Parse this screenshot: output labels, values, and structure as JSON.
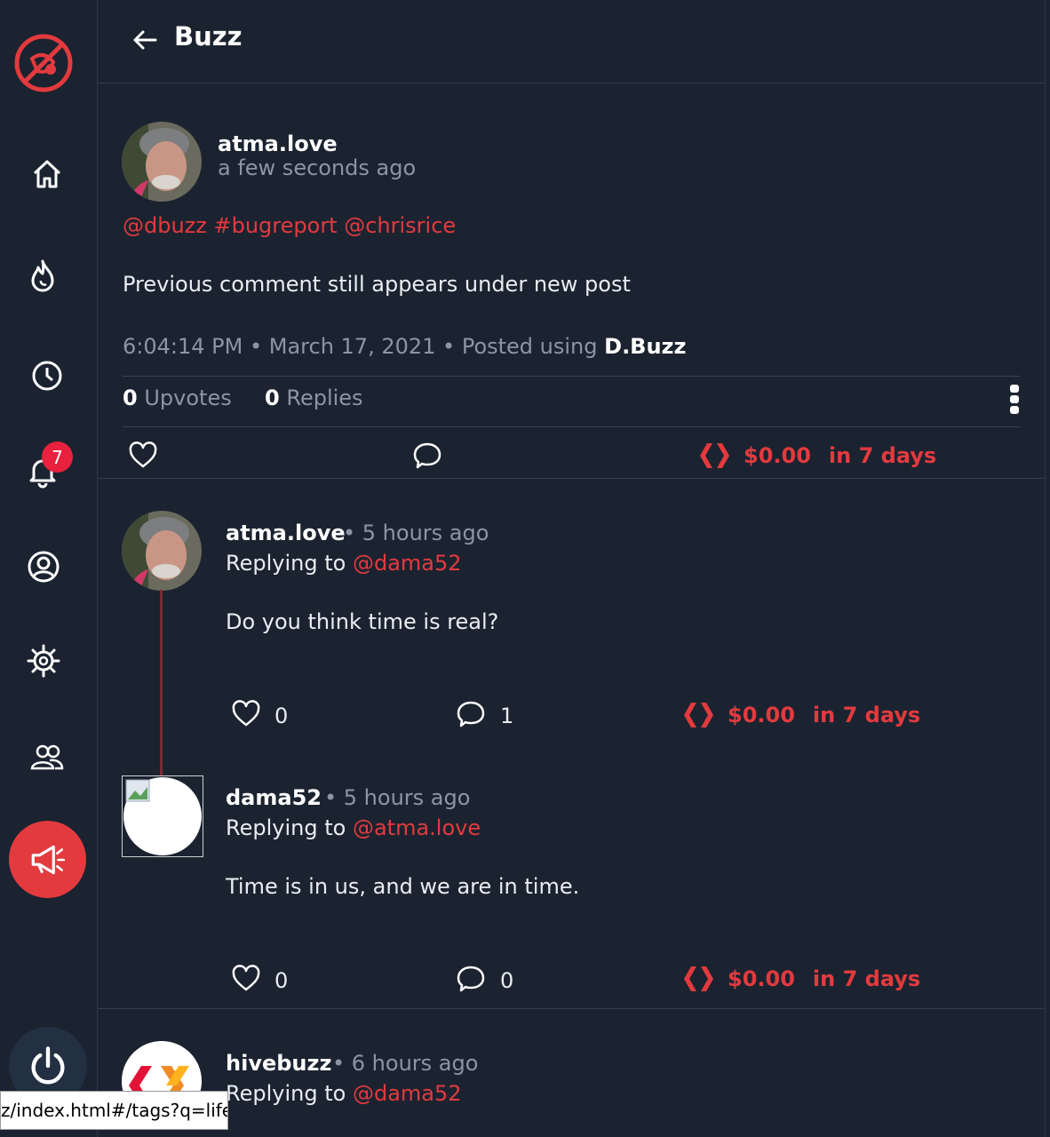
{
  "header": {
    "title": "Buzz"
  },
  "sidebar": {
    "notification_count": "7"
  },
  "post": {
    "author": "atma.love",
    "time_ago": "a few seconds ago",
    "tags": "@dbuzz #bugreport @chrisrice",
    "body": "Previous comment still appears under new post",
    "timestamp": "6:04:14 PM • March 17, 2021 • Posted using",
    "app": "D.Buzz",
    "upvotes_count": "0",
    "upvotes_label": "Upvotes",
    "replies_count": "0",
    "replies_label": "Replies",
    "payout": "$0.00",
    "payout_when": "in 7 days"
  },
  "replies": [
    {
      "author": "atma.love",
      "time_ago": "• 5 hours ago",
      "replying_label": "Replying to",
      "replying_to": "@dama52",
      "body": "Do you think time is real?",
      "likes": "0",
      "comments": "1",
      "payout": "$0.00",
      "payout_when": "in 7 days"
    },
    {
      "author": "dama52",
      "time_ago": "• 5 hours ago",
      "replying_label": "Replying to",
      "replying_to": "@atma.love",
      "body": "Time is in us, and we are in time.",
      "likes": "0",
      "comments": "0",
      "payout": "$0.00",
      "payout_when": "in 7 days"
    },
    {
      "author": "hivebuzz",
      "time_ago": "• 6 hours ago",
      "replying_label": "Replying to",
      "replying_to": "@dama52"
    }
  ],
  "status_bar": {
    "url": "z/index.html#/tags?q=life"
  },
  "colors": {
    "accent": "#e33a3e",
    "background": "#1b2330",
    "muted": "#8b96a4"
  }
}
